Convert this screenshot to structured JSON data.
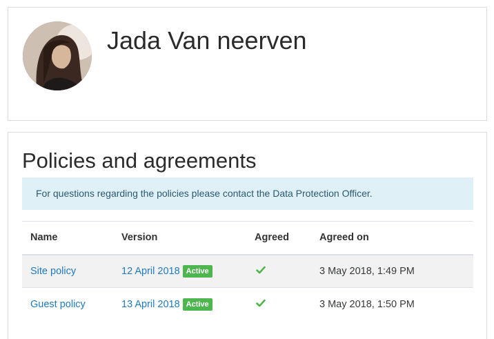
{
  "profile": {
    "name": "Jada Van neerven"
  },
  "policies": {
    "title": "Policies and agreements",
    "notice": "For questions regarding the policies please contact the Data Protection Officer.",
    "columns": {
      "name": "Name",
      "version": "Version",
      "agreed": "Agreed",
      "agreed_on": "Agreed on"
    },
    "rows": [
      {
        "name": "Site policy",
        "version": "12 April 2018",
        "badge": "Active",
        "agreed_icon": "check-icon",
        "agreed_on": "3 May 2018, 1:49 PM"
      },
      {
        "name": "Guest policy",
        "version": "13 April 2018",
        "badge": "Active",
        "agreed_icon": "check-icon",
        "agreed_on": "3 May 2018, 1:50 PM"
      }
    ]
  },
  "colors": {
    "link": "#1f7ac2",
    "badge_active": "#4fb54f",
    "check": "#4fb54f",
    "alert_bg": "#dff0f7"
  }
}
